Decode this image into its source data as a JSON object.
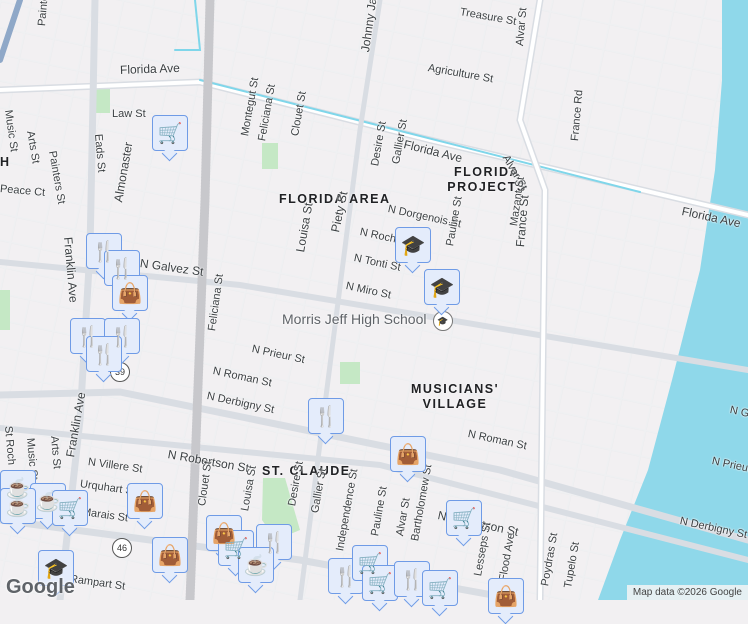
{
  "map": {
    "areas": [
      "FLORIDA AREA",
      "FLORIDA PROJECTS",
      "MUSICIANS' VILLAGE",
      "ST. CLAUDE"
    ],
    "poi": "Morris Jeff High School",
    "streets": {
      "florida_ave_1": "Florida Ave",
      "florida_ave_2": "Florida Ave",
      "florida_ave_3": "Florida Ave",
      "treasure": "Treasure St",
      "agriculture": "Agriculture St",
      "alvar_n": "Alvar St",
      "alvar_2": "Alvar St",
      "france_rd": "France Rd",
      "johnny": "Johnny Jackson",
      "painters_top": "Painters St",
      "law": "Law St",
      "music_top": "Music St",
      "arts_top": "Arts St",
      "painters": "Painters St",
      "eads": "Eads St",
      "almonaster": "Almonaster",
      "peace": "Peace Ct",
      "franklin": "Franklin Ave",
      "montegut": "Montegut St",
      "feliciana_top": "Feliciana St",
      "clouet_top": "Clouet St",
      "desire_top": "Desire St",
      "gallier_top": "Gallier St",
      "dorgenois": "N Dorgenois St",
      "roch": "N Roch St",
      "tonti": "N Tonti St",
      "miro": "N Miro St",
      "louisa": "Louisa St",
      "piety": "Piety St",
      "pauline": "Pauline St",
      "mazant": "Mazant St",
      "france": "France St",
      "galvez": "N Galvez St",
      "feliciana": "Feliciana St",
      "prieur": "N Prieur St",
      "roman": "N Roman St",
      "roman2": "N Roman St",
      "derbigny": "N Derbigny St",
      "robertson": "N Robertson St",
      "robertson2": "N Robertson St",
      "villere": "N Villere St",
      "urquhart": "Urquhart St",
      "marais": "Marais St",
      "rampart": "Rampart St",
      "st_roch": "St Roch",
      "music": "Music St",
      "arts": "Arts St",
      "clouet": "Clouet St",
      "louisa2": "Louisa St",
      "desire": "Desire St",
      "gallier": "Gallier St",
      "independence": "Independence St",
      "pauline2": "Pauline St",
      "alvar3": "Alvar St",
      "lesseps": "Lesseps St",
      "flood": "Flood Ave",
      "bartholomew": "Bartholomew St",
      "montegut2": "Montegut St",
      "clouet2": "Clouet St",
      "poydras": "Poydras St",
      "tupelo": "Tupelo St",
      "derbigny_r": "N Derbigny St",
      "prieur_r": "N Prieur St",
      "galvez_r": "N Ga",
      "florida_r": "Florida Ave"
    },
    "route_shields": [
      "39",
      "46"
    ],
    "left_edge_h": "H",
    "marker_icons": {
      "school": "🎓",
      "restaurant": "🍴",
      "shopping": "👜",
      "grocery": "🛒",
      "cafe": "☕"
    },
    "logo": "Google",
    "attribution": "Map data ©2026 Google"
  },
  "colors": {
    "water": "#8fd8ea",
    "park": "#c5e8c5",
    "road": "#ffffff",
    "arterial": "#d9dde3",
    "rail": "#c8c8cc",
    "marker_bg": "#e4ecfb",
    "marker_border": "#6f9be6",
    "marker_glyph": "#0c3a5c",
    "cyan_line": "#7fd6ea"
  }
}
